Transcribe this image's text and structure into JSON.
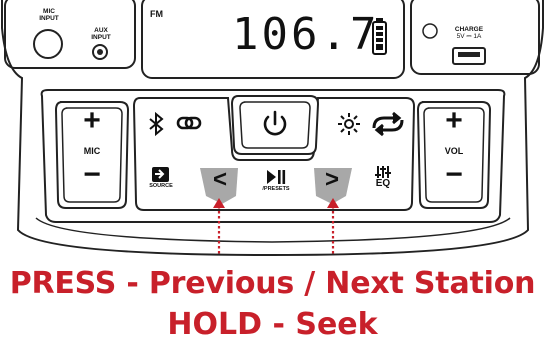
{
  "panel": {
    "mic_input_label": [
      "MIC",
      "INPUT"
    ],
    "aux_input_label": [
      "AUX",
      "INPUT"
    ],
    "fm_label": "FM",
    "frequency": "106.7",
    "charge_label": "CHARGE",
    "charge_spec": "5V ⎓ 1A",
    "mic_label": "MIC",
    "vol_label": "VOL",
    "plus": "+",
    "minus": "−",
    "source_label": "SOURCE",
    "presets_label": "/PRESETS",
    "eq_label": "EQ",
    "prev_glyph": "<",
    "next_glyph": ">"
  },
  "icons": {
    "bluetooth": "bluetooth-icon",
    "link": "link-icon",
    "power": "power-icon",
    "light": "light-icon",
    "repeat": "repeat-icon",
    "source": "source-icon",
    "play_pause": "play-pause-icon",
    "eq": "eq-icon",
    "battery": "battery-icon",
    "usb": "usb-icon"
  },
  "captions": {
    "line1": "PRESS - Previous / Next Station",
    "line2": "HOLD - Seek"
  },
  "colors": {
    "accent": "#c8202a",
    "highlight": "#a8a8a8"
  }
}
